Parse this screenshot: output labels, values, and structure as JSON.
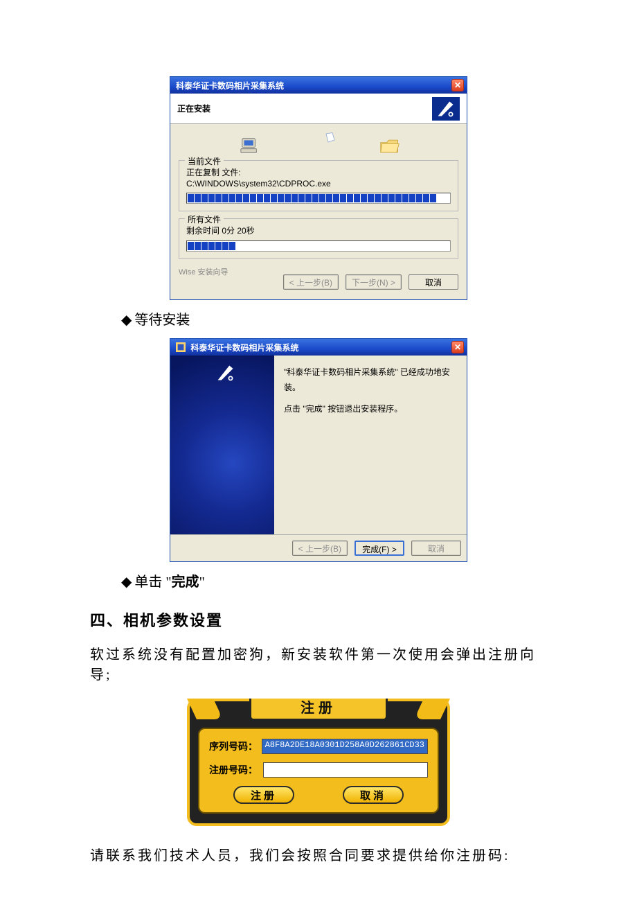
{
  "installer1": {
    "title": "科泰华证卡数码相片采集系统",
    "heading": "正在安装",
    "group_current": "当前文件",
    "copy_label": "正在复制 文件:",
    "copy_path": "C:\\WINDOWS\\system32\\CDPROC.exe",
    "group_all": "所有文件",
    "remaining": "剩余时间 0分 20秒",
    "wizard": "Wise 安装向导",
    "btn_back": "< 上一步(B)",
    "btn_next": "下一步(N) >",
    "btn_cancel": "取消"
  },
  "bullet1": "等待安装",
  "installer2": {
    "title": "科泰华证卡数码相片采集系统",
    "line1": "\"科泰华证卡数码相片采集系统\" 已经成功地安装。",
    "line2": "点击 \"完成\" 按钮退出安装程序。",
    "btn_back": "< 上一步(B)",
    "btn_finish": "完成(F) >",
    "btn_cancel": "取消"
  },
  "bullet2_pre": "单击 \"",
  "bullet2_strong": "完成",
  "bullet2_post": "\"",
  "section4": "四、相机参数设置",
  "para1": "软过系统没有配置加密狗，新安装软件第一次使用会弹出注册向导;",
  "reg": {
    "title": "注册",
    "serial_label": "序列号码：",
    "serial_value": "A8F8A2DE18A0301D258A0D262861CD33",
    "regno_label": "注册号码：",
    "regno_value": "",
    "btn_register": "注册",
    "btn_cancel": "取消"
  },
  "para2": "请联系我们技术人员，我们会按照合同要求提供给你注册码:"
}
